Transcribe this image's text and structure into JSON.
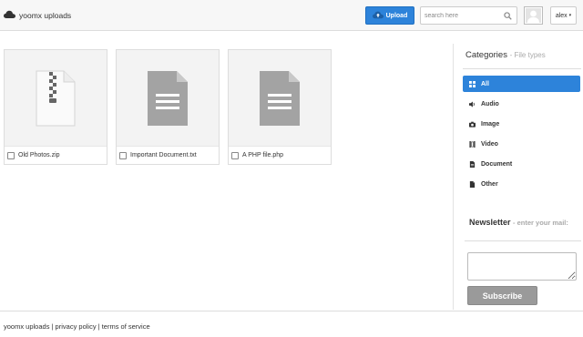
{
  "header": {
    "brand": "yoomx uploads",
    "upload_label": "Upload",
    "search_placeholder": "search here",
    "user_name": "alex",
    "user_caret": "▾"
  },
  "files": [
    {
      "name": "Old Photos.zip",
      "icon": "zip-file-icon"
    },
    {
      "name": "Important Document.txt",
      "icon": "document-icon"
    },
    {
      "name": "A PHP file.php",
      "icon": "document-icon"
    }
  ],
  "sidebar": {
    "heading": "Categories",
    "subheading": "- File types",
    "categories": [
      {
        "label": "All",
        "icon": "grid-icon",
        "active": true
      },
      {
        "label": "Audio",
        "icon": "speaker-icon",
        "active": false
      },
      {
        "label": "Image",
        "icon": "camera-icon",
        "active": false
      },
      {
        "label": "Video",
        "icon": "film-icon",
        "active": false
      },
      {
        "label": "Document",
        "icon": "document-icon",
        "active": false
      },
      {
        "label": "Other",
        "icon": "file-icon",
        "active": false
      }
    ],
    "newsletter_heading": "Newsletter",
    "newsletter_sub": "- enter your mail:",
    "newsletter_value": "",
    "subscribe_label": "Subscribe"
  },
  "footer": {
    "text": "yoomx uploads | privacy policy | terms of service"
  },
  "colors": {
    "accent": "#2d83da",
    "topbar": "#f7f7f7",
    "file_icon_gray": "#a3a3a3",
    "subscribe_gray": "#9a9a9a"
  }
}
